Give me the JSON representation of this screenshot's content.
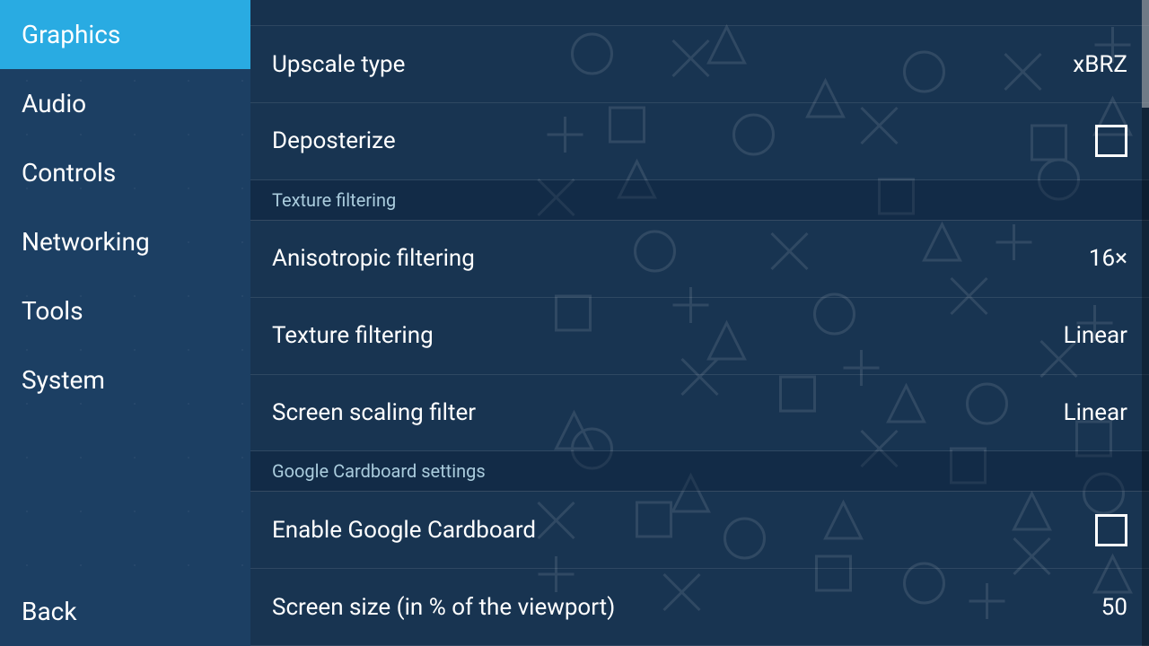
{
  "sidebar": {
    "items": [
      {
        "id": "graphics",
        "label": "Graphics",
        "active": true
      },
      {
        "id": "audio",
        "label": "Audio",
        "active": false
      },
      {
        "id": "controls",
        "label": "Controls",
        "active": false
      },
      {
        "id": "networking",
        "label": "Networking",
        "active": false
      },
      {
        "id": "tools",
        "label": "Tools",
        "active": false
      },
      {
        "id": "system",
        "label": "System",
        "active": false
      }
    ],
    "back_label": "Back"
  },
  "sections": [
    {
      "id": "upscaling",
      "header": null,
      "rows": [
        {
          "id": "upscale-type",
          "label": "Upscale type",
          "value": "xBRZ",
          "type": "value"
        },
        {
          "id": "deposterize",
          "label": "Deposterize",
          "value": "",
          "type": "checkbox",
          "checked": false
        }
      ]
    },
    {
      "id": "texture-filtering-section",
      "header": "Texture filtering",
      "rows": [
        {
          "id": "anisotropic-filtering",
          "label": "Anisotropic filtering",
          "value": "16×",
          "type": "value"
        },
        {
          "id": "texture-filtering",
          "label": "Texture filtering",
          "value": "Linear",
          "type": "value"
        },
        {
          "id": "screen-scaling-filter",
          "label": "Screen scaling filter",
          "value": "Linear",
          "type": "value"
        }
      ]
    },
    {
      "id": "google-cardboard-section",
      "header": "Google Cardboard settings",
      "rows": [
        {
          "id": "enable-google-cardboard",
          "label": "Enable Google Cardboard",
          "value": "",
          "type": "checkbox",
          "checked": false
        },
        {
          "id": "screen-size-viewport",
          "label": "Screen size (in % of the viewport)",
          "value": "50",
          "type": "value"
        }
      ]
    }
  ],
  "colors": {
    "sidebar_bg": "#1c3f63",
    "sidebar_active": "#29abe2",
    "main_bg": "#1e4060",
    "text_primary": "#ffffff",
    "text_secondary": "#aaccdd",
    "section_header_bg": "#0a1e37"
  }
}
